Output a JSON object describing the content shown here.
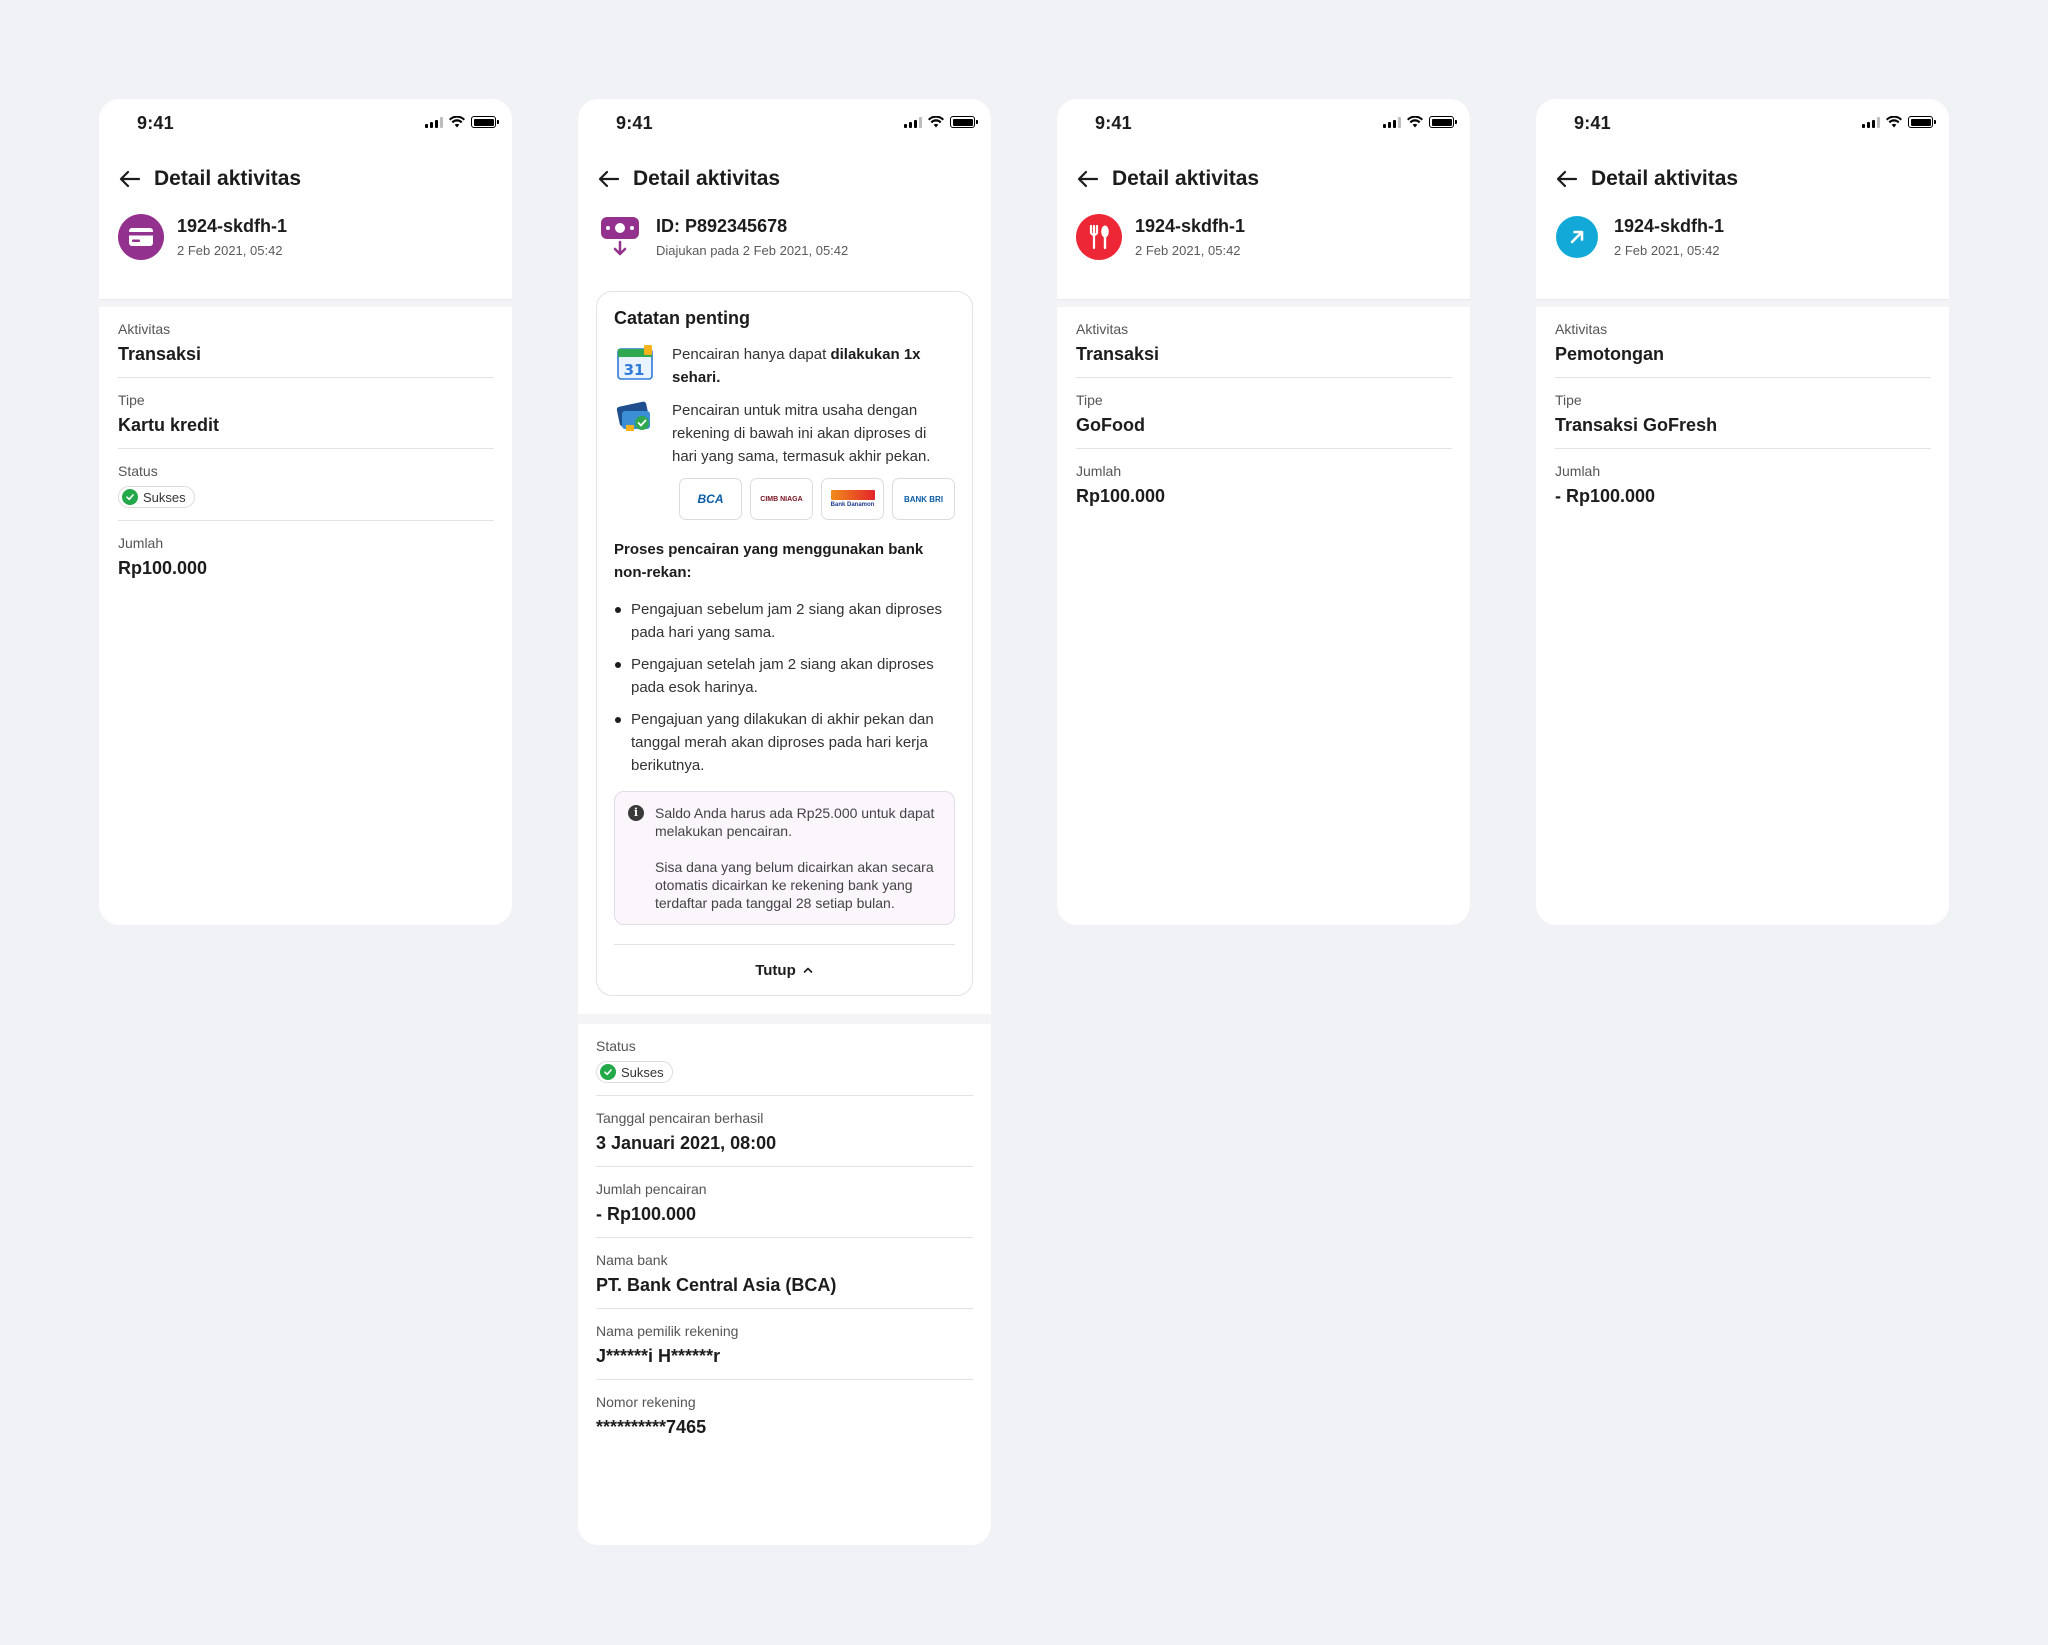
{
  "status_time": "9:41",
  "nav_title": "Detail aktivitas",
  "phones": [
    {
      "id": "1924-skdfh-1",
      "date": "2 Feb 2021, 05:42",
      "icon": "credit-card-icon",
      "icon_color": "#93328e",
      "rows": {
        "aktivitas_label": "Aktivitas",
        "aktivitas": "Transaksi",
        "tipe_label": "Tipe",
        "tipe": "Kartu kredit",
        "status_label": "Status",
        "status": "Sukses",
        "jumlah_label": "Jumlah",
        "jumlah": "Rp100.000"
      }
    },
    {
      "id": "ID: P892345678",
      "date": "Diajukan pada 2 Feb 2021, 05:42",
      "icon": "withdraw-icon",
      "icon_color": "#93328e",
      "notes": {
        "title": "Catatan penting",
        "note1_a": "Pencairan hanya dapat ",
        "note1_b": "dilakukan 1x sehari.",
        "note2": "Pencairan untuk mitra usaha dengan rekening di bawah ini akan diproses di hari yang sama, termasuk akhir pekan.",
        "banks": [
          "BCA",
          "CIMB NIAGA",
          "Bank Danamon",
          "BANK BRI"
        ],
        "subtitle": "Proses pencairan yang menggunakan bank non-rekan:",
        "bullets": [
          "Pengajuan sebelum jam 2 siang akan diproses pada hari yang sama.",
          "Pengajuan setelah jam 2 siang akan diproses pada esok harinya.",
          "Pengajuan yang dilakukan di akhir pekan dan tanggal merah akan diproses pada hari kerja berikutnya."
        ],
        "info1": "Saldo Anda harus ada Rp25.000 untuk dapat melakukan pencairan.",
        "info2": "Sisa dana yang belum dicairkan akan secara otomatis dicairkan ke rekening bank yang terdaftar pada tanggal 28 setiap bulan.",
        "close": "Tutup"
      },
      "rows": {
        "status_label": "Status",
        "status": "Sukses",
        "tanggal_label": "Tanggal pencairan berhasil",
        "tanggal": "3 Januari 2021, 08:00",
        "jumlah_label": "Jumlah pencairan",
        "jumlah": "- Rp100.000",
        "bank_label": "Nama bank",
        "bank": "PT. Bank Central Asia (BCA)",
        "pemilik_label": "Nama pemilik rekening",
        "pemilik": "J******i H******r",
        "nomor_label": "Nomor rekening",
        "nomor": "**********7465"
      }
    },
    {
      "id": "1924-skdfh-1",
      "date": "2 Feb 2021, 05:42",
      "icon": "fork-spoon-icon",
      "icon_color": "#ee2737",
      "rows": {
        "aktivitas_label": "Aktivitas",
        "aktivitas": "Transaksi",
        "tipe_label": "Tipe",
        "tipe": "GoFood",
        "jumlah_label": "Jumlah",
        "jumlah": "Rp100.000"
      }
    },
    {
      "id": "1924-skdfh-1",
      "date": "2 Feb 2021, 05:42",
      "icon": "arrow-up-right-icon",
      "icon_color": "#12a9d8",
      "rows": {
        "aktivitas_label": "Aktivitas",
        "aktivitas": "Pemotongan",
        "tipe_label": "Tipe",
        "tipe": "Transaksi GoFresh",
        "jumlah_label": "Jumlah",
        "jumlah": "- Rp100.000"
      }
    }
  ]
}
